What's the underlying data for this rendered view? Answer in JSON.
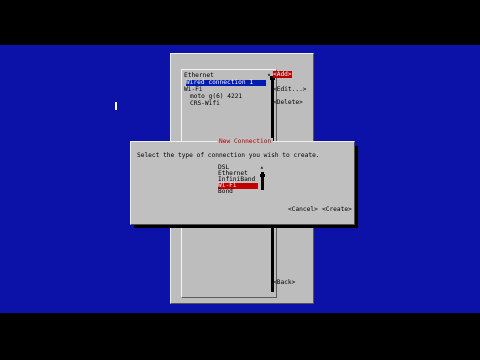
{
  "main": {
    "entries": [
      {
        "label": "Ethernet",
        "kind": "header"
      },
      {
        "label": "Wired connection 1",
        "kind": "selected"
      },
      {
        "label": "Wi-Fi",
        "kind": "header"
      },
      {
        "label": "moto g(6) 4221",
        "kind": "item"
      },
      {
        "label": "CRS-Wifi",
        "kind": "item"
      }
    ],
    "scroll_up": "▴",
    "buttons": {
      "add": "<Add>",
      "edit": "<Edit...>",
      "delete": "<Delete>",
      "back": "<Back>"
    }
  },
  "new_connection": {
    "title": "New Connection",
    "prompt": "Select the type of connection you wish to create.",
    "types": [
      "DSL",
      "Ethernet",
      "InfiniBand",
      "Wi-Fi",
      "Bond"
    ],
    "selected": "Wi-Fi",
    "scroll_up": "▴",
    "cancel": "<Cancel>",
    "create": "<Create>"
  },
  "colors": {
    "screen": "#0c12a8",
    "dialog": "#bdbdbd",
    "focus": "#b60000",
    "selected": "#001bb0"
  }
}
